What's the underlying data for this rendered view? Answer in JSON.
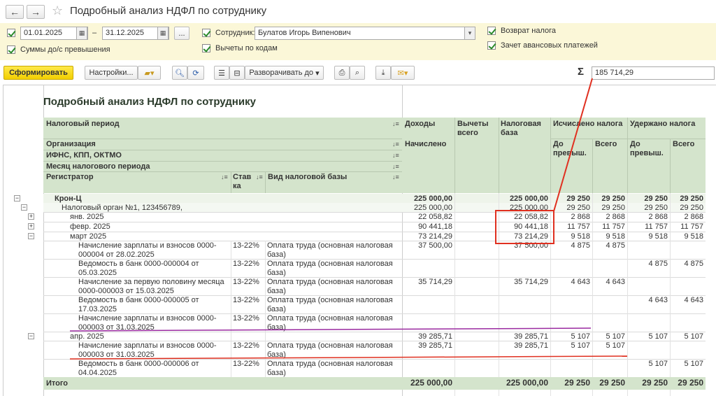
{
  "window": {
    "title": "Подробный анализ НДФЛ по сотруднику"
  },
  "filters": {
    "date_from": "01.01.2025",
    "date_sep": "–",
    "date_to": "31.12.2025",
    "period_button": "...",
    "employee_label": "Сотрудник:",
    "employee_value": "Булатов Игорь Випенович",
    "sums_label": "Суммы до/с превышения",
    "deductions_label": "Вычеты по кодам",
    "refund_label": "Возврат налога",
    "advance_label": "Зачет авансовых платежей"
  },
  "toolbar": {
    "generate": "Сформировать",
    "settings": "Настройки...",
    "expand": "Разворачивать до",
    "sum_sign": "Σ",
    "sum_value": "185 714,29"
  },
  "report": {
    "title": "Подробный анализ НДФЛ по сотруднику",
    "headers": {
      "period": "Налоговый период",
      "org": "Организация",
      "ifns": "ИФНС, КПП, ОКТМО",
      "month": "Месяц налогового периода",
      "registrar": "Регистратор",
      "rate": "Став ка",
      "base_type": "Вид налоговой базы",
      "income": "Доходы",
      "accrued": "Начислено",
      "deductions": "Вычеты всего",
      "tax_base": "Налоговая база",
      "calc": "Исчислено налога",
      "withheld": "Удержано налога",
      "before_exc": "До превыш.",
      "total": "Всего"
    },
    "rows": [
      {
        "label": "Крон-Ц",
        "income": "225 000,00",
        "deduction": "",
        "base": "225 000,00",
        "calc_before": "29 250",
        "calc_total": "29 250",
        "with_before": "29 250",
        "with_total": "29 250"
      },
      {
        "label": "Налоговый орган №1, 123456789,",
        "income": "225 000,00",
        "deduction": "",
        "base": "225 000,00",
        "calc_before": "29 250",
        "calc_total": "29 250",
        "with_before": "29 250",
        "with_total": "29 250"
      },
      {
        "label": "янв. 2025",
        "income": "22 058,82",
        "deduction": "",
        "base": "22 058,82",
        "calc_before": "2 868",
        "calc_total": "2 868",
        "with_before": "2 868",
        "with_total": "2 868"
      },
      {
        "label": "февр. 2025",
        "income": "90 441,18",
        "deduction": "",
        "base": "90 441,18",
        "calc_before": "11 757",
        "calc_total": "11 757",
        "with_before": "11 757",
        "with_total": "11 757"
      },
      {
        "label": "март 2025",
        "income": "73 214,29",
        "deduction": "",
        "base": "73 214,29",
        "calc_before": "9 518",
        "calc_total": "9 518",
        "with_before": "9 518",
        "with_total": "9 518"
      },
      {
        "label": "Начисление зарплаты и взносов 0000-000004 от 28.02.2025",
        "rate": "13-22%",
        "type": "Оплата труда (основная налоговая база)",
        "income": "37 500,00",
        "deduction": "",
        "base": "37 500,00",
        "calc_before": "4 875",
        "calc_total": "4 875",
        "with_before": "",
        "with_total": ""
      },
      {
        "label": "Ведомость в банк 0000-000004 от 05.03.2025",
        "rate": "13-22%",
        "type": "Оплата труда (основная налоговая база)",
        "income": "",
        "deduction": "",
        "base": "",
        "calc_before": "",
        "calc_total": "",
        "with_before": "4 875",
        "with_total": "4 875"
      },
      {
        "label": "Начисление за первую половину месяца 0000-000003 от 15.03.2025",
        "rate": "13-22%",
        "type": "Оплата труда (основная налоговая база)",
        "income": "35 714,29",
        "deduction": "",
        "base": "35 714,29",
        "calc_before": "4 643",
        "calc_total": "4 643",
        "with_before": "",
        "with_total": ""
      },
      {
        "label": "Ведомость в банк 0000-000005 от 17.03.2025",
        "rate": "13-22%",
        "type": "Оплата труда (основная налоговая база)",
        "income": "",
        "deduction": "",
        "base": "",
        "calc_before": "",
        "calc_total": "",
        "with_before": "4 643",
        "with_total": "4 643"
      },
      {
        "label": "Начисление зарплаты и взносов 0000-000003 от 31.03.2025",
        "rate": "13-22%",
        "type": "Оплата труда (основная налоговая база)",
        "income": "",
        "deduction": "",
        "base": "",
        "calc_before": "",
        "calc_total": "",
        "with_before": "",
        "with_total": ""
      },
      {
        "label": "апр. 2025",
        "income": "39 285,71",
        "deduction": "",
        "base": "39 285,71",
        "calc_before": "5 107",
        "calc_total": "5 107",
        "with_before": "5 107",
        "with_total": "5 107"
      },
      {
        "label": "Начисление зарплаты и взносов 0000-000003 от 31.03.2025",
        "rate": "13-22%",
        "type": "Оплата труда (основная налоговая база)",
        "income": "39 285,71",
        "deduction": "",
        "base": "39 285,71",
        "calc_before": "5 107",
        "calc_total": "5 107",
        "with_before": "",
        "with_total": ""
      },
      {
        "label": "Ведомость в банк 0000-000006 от 04.04.2025",
        "rate": "13-22%",
        "type": "Оплата труда (основная налоговая база)",
        "income": "",
        "deduction": "",
        "base": "",
        "calc_before": "",
        "calc_total": "",
        "with_before": "5 107",
        "with_total": "5 107"
      }
    ],
    "total": {
      "label": "Итого",
      "income": "225 000,00",
      "base": "225 000,00",
      "calc_before": "29 250",
      "calc_total": "29 250",
      "with_before": "29 250",
      "with_total": "29 250"
    }
  },
  "annotations": {
    "box_color": "#e03020",
    "line_red": "#e03020",
    "line_purple": "#9a2aa0"
  }
}
